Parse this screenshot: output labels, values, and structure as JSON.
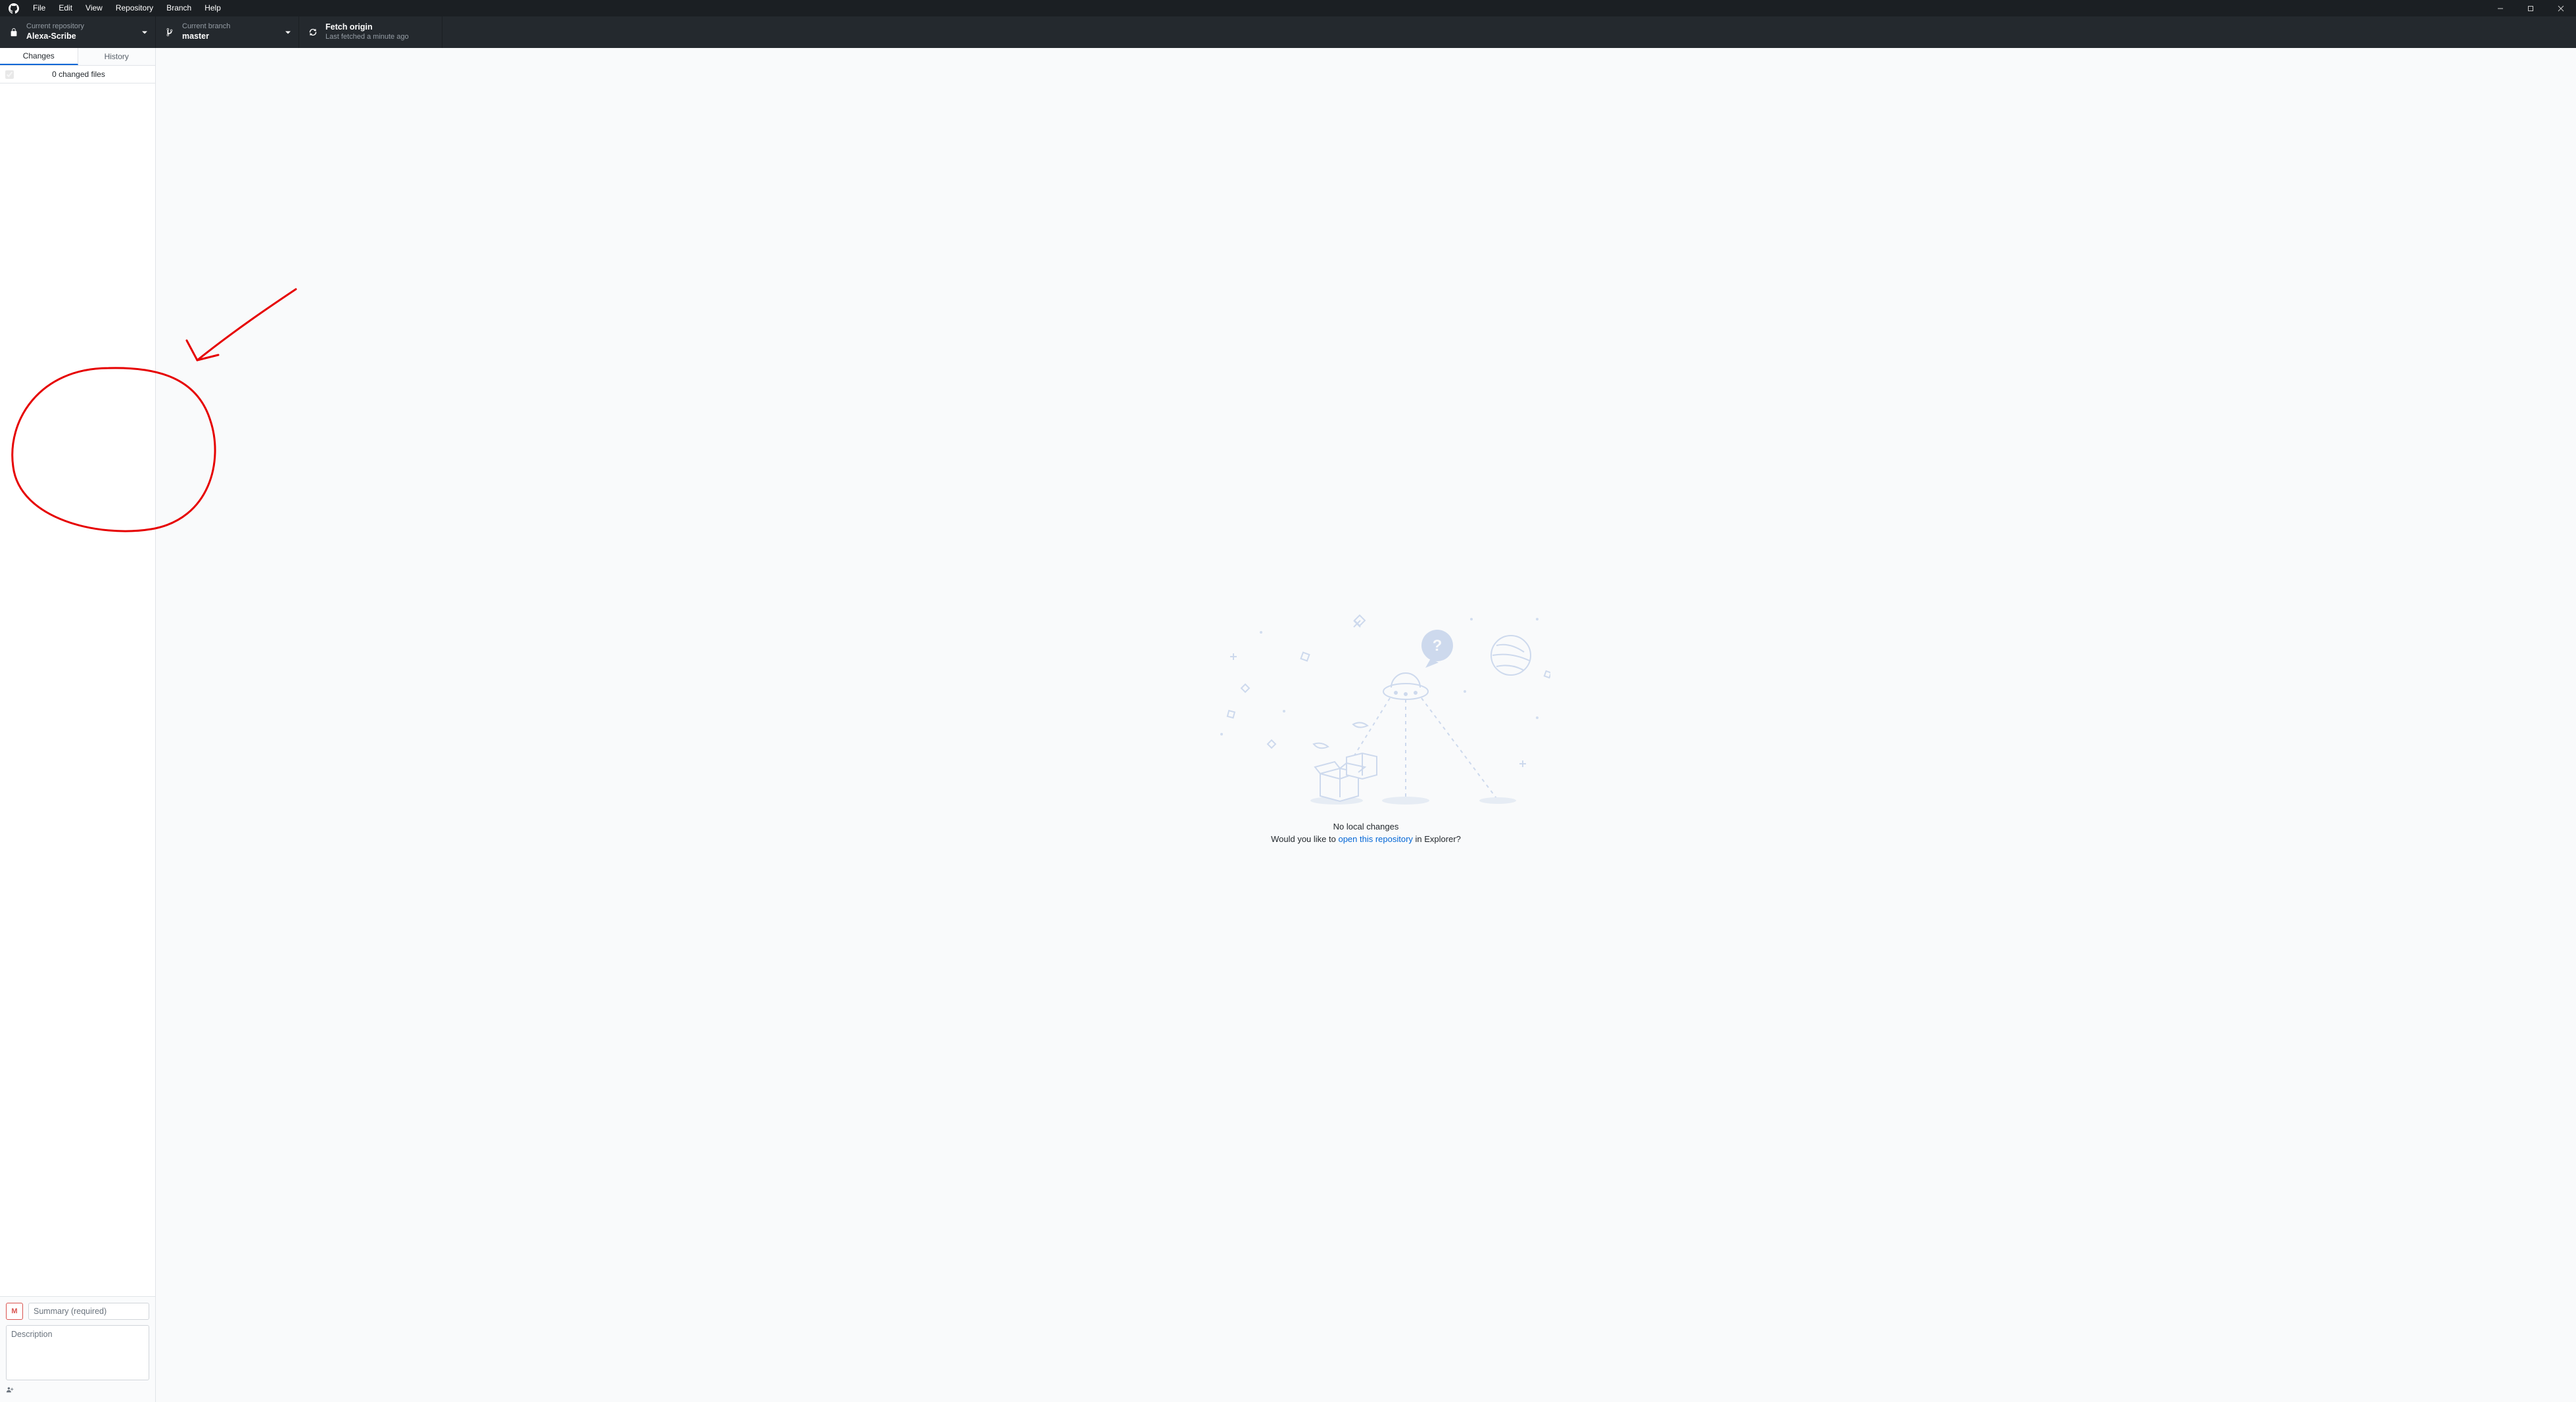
{
  "menu": {
    "items": [
      "File",
      "Edit",
      "View",
      "Repository",
      "Branch",
      "Help"
    ]
  },
  "toolbar": {
    "repo": {
      "label": "Current repository",
      "value": "Alexa-Scribe"
    },
    "branch": {
      "label": "Current branch",
      "value": "master"
    },
    "fetch": {
      "label": "Fetch origin",
      "sub": "Last fetched a minute ago"
    }
  },
  "sidebar": {
    "tabs": {
      "changes": "Changes",
      "history": "History"
    },
    "changes_header": "0 changed files"
  },
  "commit": {
    "avatar_initial": "M",
    "summary_placeholder": "Summary (required)",
    "description_placeholder": "Description"
  },
  "empty": {
    "headline": "No local changes",
    "sub_prefix": "Would you like to ",
    "sub_link": "open this repository",
    "sub_suffix": " in Explorer?"
  }
}
